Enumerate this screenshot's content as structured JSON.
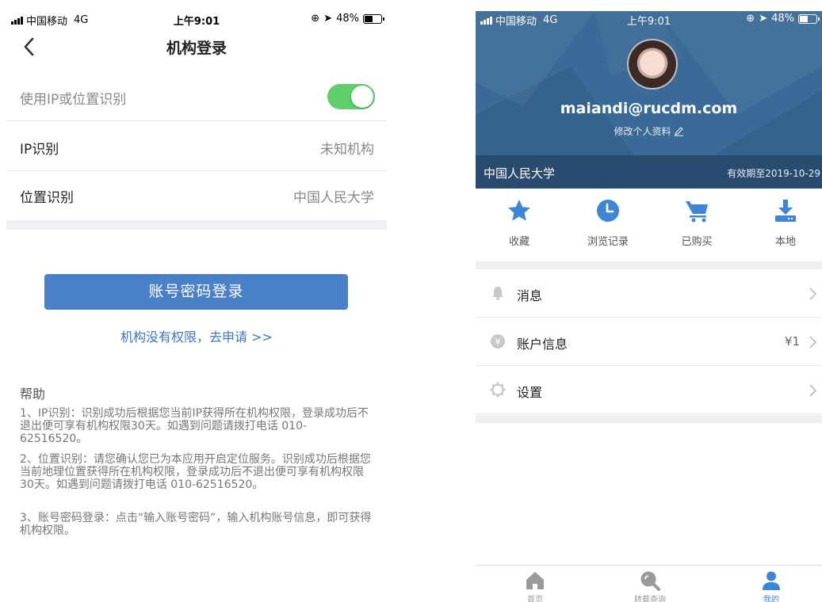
{
  "colors": {
    "accent_blue": "#4a80c8",
    "link_blue": "#3c76c4",
    "toggle_green": "#5fcf6a",
    "hero_blue": "#3a6a97",
    "icon_blue": "#3d86d6",
    "tab_active": "#3d86d6",
    "tab_inactive": "#9a9a9a"
  },
  "left": {
    "status": {
      "carrier": "中国移动",
      "network": "4G",
      "time": "上午9:01",
      "battery": "48%",
      "battery_level": 0.48
    },
    "nav": {
      "title": "机构登录",
      "back_icon": "chevron-left-icon"
    },
    "settings": {
      "ip_location_toggle": {
        "label": "使用IP或位置识别",
        "on": true
      },
      "ip_row": {
        "label": "IP识别",
        "value": "未知机构"
      },
      "location_row": {
        "label": "位置识别",
        "value": "中国人民大学"
      }
    },
    "login_button": "账号密码登录",
    "apply_link": "机构没有权限，去申请 >>",
    "help": {
      "title": "帮助",
      "items": [
        "1、IP识别：识别成功后根据您当前IP获得所在机构权限，登录成功后不退出便可享有机构权限30天。如遇到问题请拨打电话 010-62516520。",
        "2、位置识别：请您确认您已为本应用开启定位服务。识别成功后根据您当前地理位置获得所在机构权限，登录成功后不退出便可享有机构权限30天。如遇到问题请拨打电话 010-62516520。",
        "3、账号密码登录：点击“输入账号密码”，输入机构账号信息，即可获得机构权限。"
      ]
    }
  },
  "right": {
    "status": {
      "carrier": "中国移动",
      "network": "4G",
      "time": "上午9:01",
      "battery": "48%",
      "battery_level": 0.48
    },
    "profile": {
      "email": "maiandi@rucdm.com",
      "edit_label": "修改个人资料"
    },
    "org": {
      "name": "中国人民大学",
      "expiry": "有效期至2019-10-29"
    },
    "quick_actions": [
      {
        "label": "收藏",
        "icon": "star-icon"
      },
      {
        "label": "浏览记录",
        "icon": "clock-icon"
      },
      {
        "label": "已购买",
        "icon": "cart-icon"
      },
      {
        "label": "本地",
        "icon": "download-icon"
      }
    ],
    "menu": [
      {
        "label": "消息",
        "icon": "bell-icon",
        "value": ""
      },
      {
        "label": "账户信息",
        "icon": "yen-icon",
        "value": "¥1"
      },
      {
        "label": "设置",
        "icon": "gear-icon",
        "value": ""
      }
    ],
    "tabs": [
      {
        "label": "首页",
        "icon": "home-icon",
        "active": false
      },
      {
        "label": "转载查询",
        "icon": "search-icon",
        "active": false
      },
      {
        "label": "我的",
        "icon": "user-icon",
        "active": true
      }
    ]
  }
}
